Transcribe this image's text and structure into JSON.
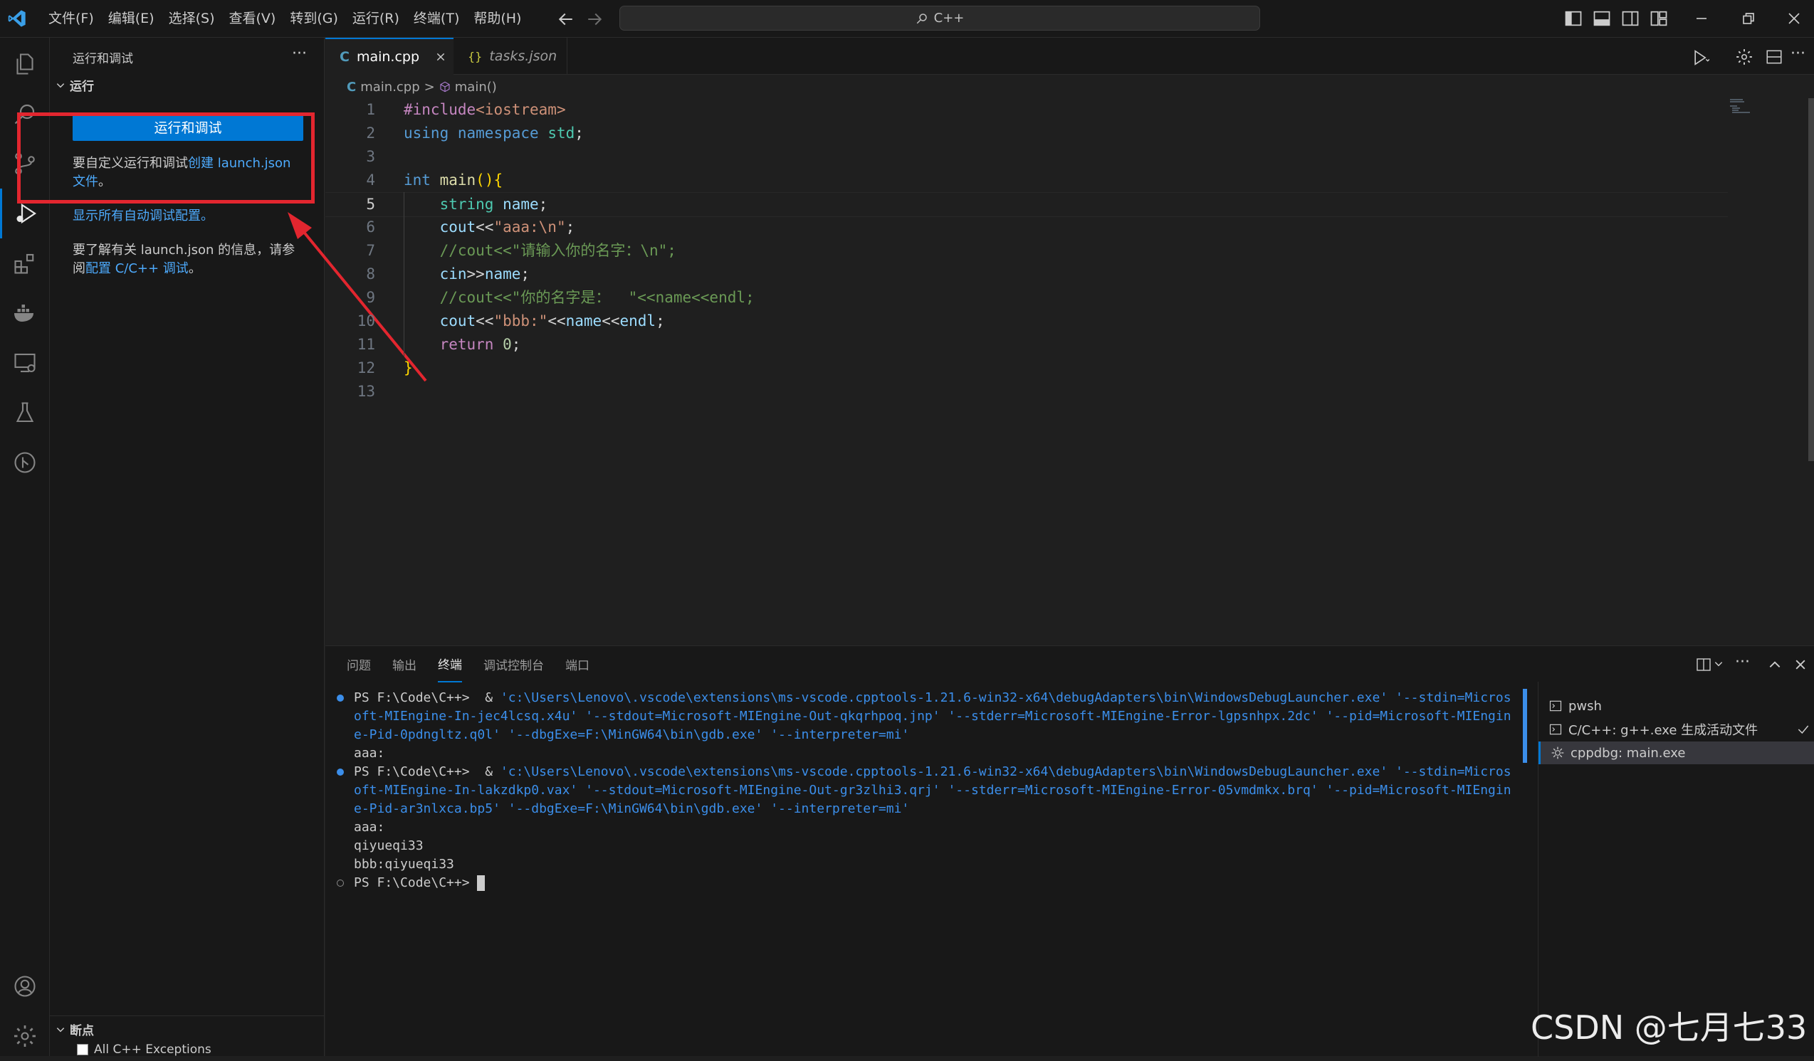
{
  "menubar": [
    "文件(F)",
    "编辑(E)",
    "选择(S)",
    "查看(V)",
    "转到(G)",
    "运行(R)",
    "终端(T)",
    "帮助(H)"
  ],
  "command_center": {
    "text": "C++"
  },
  "sidebar": {
    "title": "运行和调试",
    "more": "···",
    "run_section": "运行",
    "run_button": "运行和调试",
    "customize_prefix": "要自定义运行和调试",
    "customize_link": "创建 launch.json 文件",
    "customize_suffix": "。",
    "show_all_link": "显示所有自动调试配置。",
    "learn_prefix": "要了解有关 launch.json 的信息，请参阅",
    "learn_link": "配置 C/C++ 调试",
    "learn_suffix": "。",
    "breakpoints_section": "断点",
    "breakpoint_item": "All C++ Exceptions"
  },
  "tabs": [
    {
      "label": "main.cpp",
      "active": true
    },
    {
      "label": "tasks.json",
      "active": false
    }
  ],
  "breadcrumb": {
    "file": "main.cpp",
    "symbol": "main()"
  },
  "code_lines": [
    {
      "n": "1",
      "text": "#include<iostream>"
    },
    {
      "n": "2",
      "text": "using namespace std;"
    },
    {
      "n": "3",
      "text": ""
    },
    {
      "n": "4",
      "text": "int main(){"
    },
    {
      "n": "5",
      "text": "    string name;"
    },
    {
      "n": "6",
      "text": "    cout<<\"aaa:\\n\";"
    },
    {
      "n": "7",
      "text": "    //cout<<\"请输入你的名字：\\n\";"
    },
    {
      "n": "8",
      "text": "    cin>>name;"
    },
    {
      "n": "9",
      "text": "    //cout<<\"你的名字是：  \"<<name<<endl;"
    },
    {
      "n": "10",
      "text": "    cout<<\"bbb:\"<<name<<endl;"
    },
    {
      "n": "11",
      "text": "    return 0;"
    },
    {
      "n": "12",
      "text": "}"
    },
    {
      "n": "13",
      "text": ""
    }
  ],
  "panel": {
    "tabs": [
      "问题",
      "输出",
      "终端",
      "调试控制台",
      "端口"
    ],
    "terminal_lines": [
      {
        "prompt": "PS F:\\Code\\C++>  & ",
        "path": "'c:\\Users\\Lenovo\\.vscode\\extensions\\ms-vscode.cpptools-1.21.6-win32-x64\\debugAdapters\\bin\\WindowsDebugLauncher.exe' '--stdin=Micros"
      },
      {
        "text": "oft-MIEngine-In-jec4lcsq.x4u' '--stdout=Microsoft-MIEngine-Out-qkqrhpoq.jnp' '--stderr=Microsoft-MIEngine-Error-lgpsnhpx.2dc' '--pid=Microsoft-MIEngin"
      },
      {
        "text": "e-Pid-0pdngltz.q0l' '--dbgExe=F:\\MinGW64\\bin\\gdb.exe' '--interpreter=mi'"
      },
      {
        "plain": "aaa:"
      },
      {
        "prompt": "PS F:\\Code\\C++>  & ",
        "path": "'c:\\Users\\Lenovo\\.vscode\\extensions\\ms-vscode.cpptools-1.21.6-win32-x64\\debugAdapters\\bin\\WindowsDebugLauncher.exe' '--stdin=Micros"
      },
      {
        "text": "oft-MIEngine-In-lakzdkp0.vax' '--stdout=Microsoft-MIEngine-Out-gr3zlhi3.qrj' '--stderr=Microsoft-MIEngine-Error-05vmdmkx.brq' '--pid=Microsoft-MIEngin"
      },
      {
        "text": "e-Pid-ar3nlxca.bp5' '--dbgExe=F:\\MinGW64\\bin\\gdb.exe' '--interpreter=mi'"
      },
      {
        "plain": "aaa:"
      },
      {
        "plain": "qiyueqi33"
      },
      {
        "plain": "bbb:qiyueqi33"
      },
      {
        "plain": "PS F:\\Code\\C++> "
      }
    ],
    "terminals": [
      {
        "label": "pwsh"
      },
      {
        "label": "C/C++: g++.exe 生成活动文件"
      },
      {
        "label": "cppdbg: main.exe"
      }
    ]
  },
  "watermark": "CSDN @七月七33",
  "colors": {
    "accent": "#0078d4",
    "highlight": "#e3262f",
    "link": "#4daafc"
  }
}
